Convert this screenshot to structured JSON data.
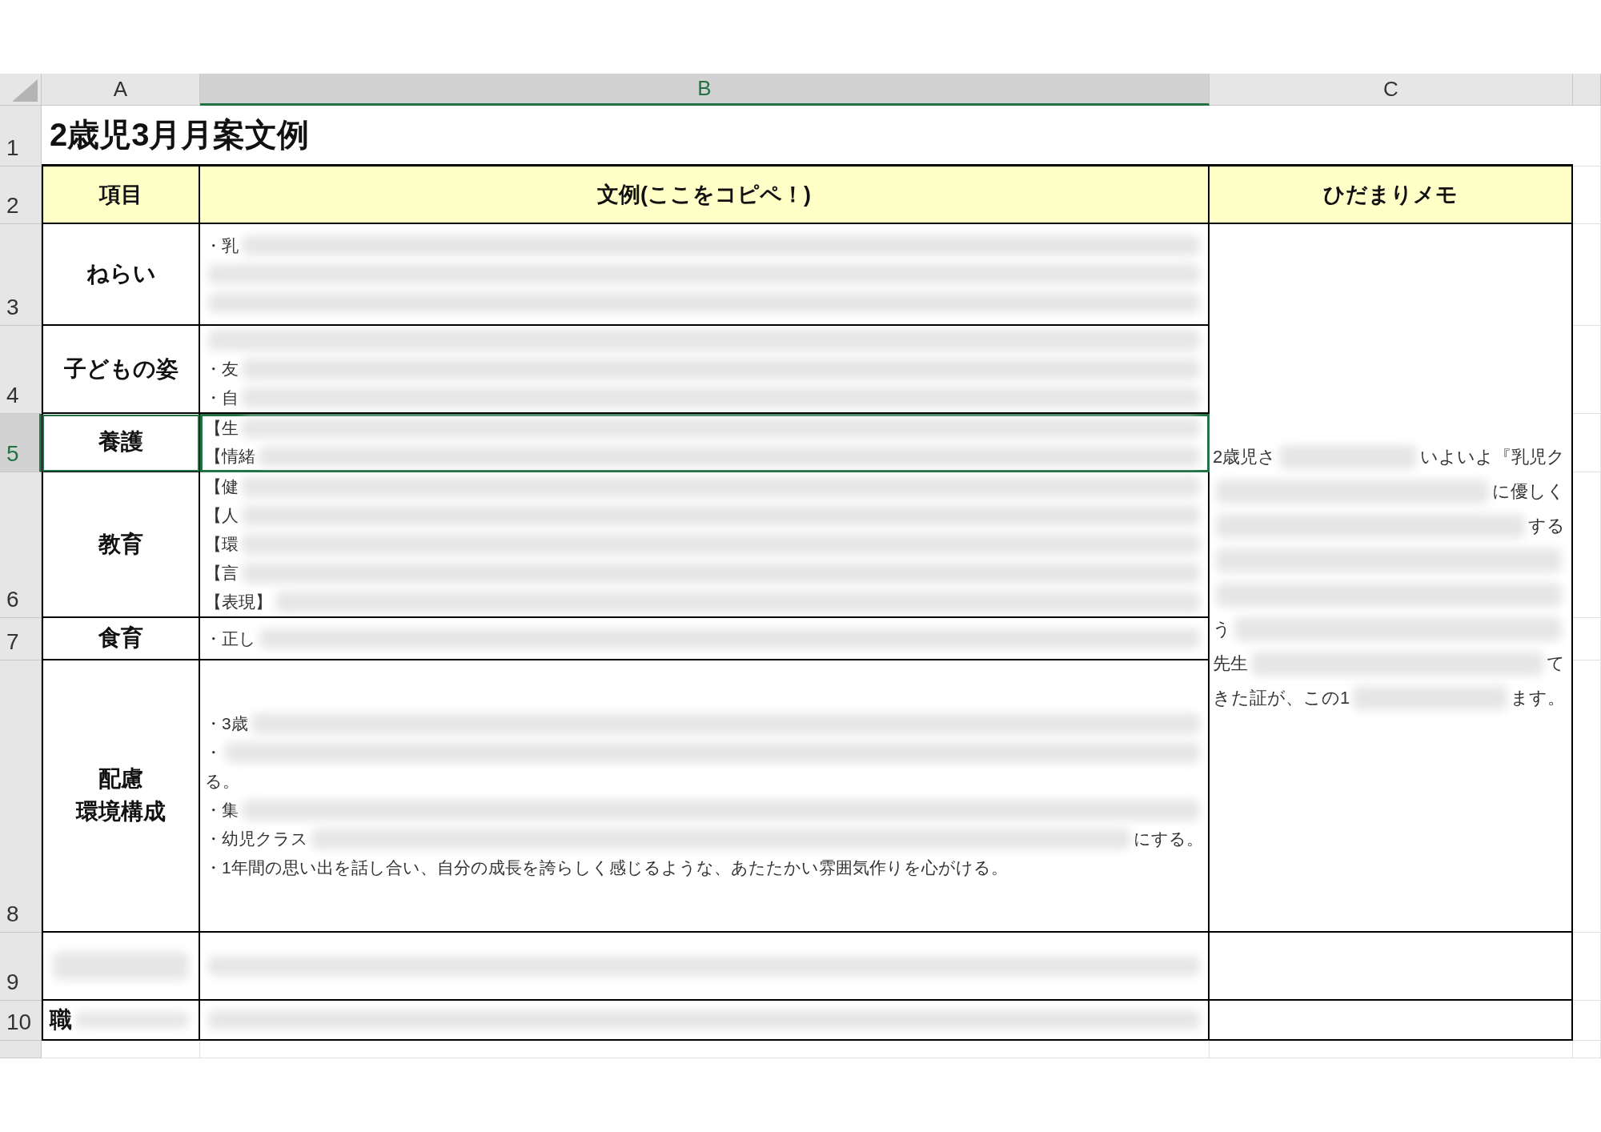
{
  "sheet": {
    "columns": [
      {
        "label": "A",
        "selected": false
      },
      {
        "label": "B",
        "selected": true
      },
      {
        "label": "C",
        "selected": false
      }
    ],
    "rows": [
      {
        "label": "1",
        "selected": false
      },
      {
        "label": "2",
        "selected": false
      },
      {
        "label": "3",
        "selected": false
      },
      {
        "label": "4",
        "selected": false
      },
      {
        "label": "5",
        "selected": true
      },
      {
        "label": "6",
        "selected": false
      },
      {
        "label": "7",
        "selected": false
      },
      {
        "label": "8",
        "selected": false
      },
      {
        "label": "9",
        "selected": false
      },
      {
        "label": "10",
        "selected": false
      }
    ],
    "title": "2歳児3月月案文例",
    "headers": [
      "項目",
      "文例(ここをコピペ！)",
      "ひだまりメモ"
    ],
    "items": [
      {
        "label": "ねらい",
        "selected": false,
        "lines": [
          {
            "text": "・乳",
            "redacted": true
          },
          {
            "redacted": true
          },
          {
            "redacted": true
          }
        ]
      },
      {
        "label": "子どもの姿",
        "selected": false,
        "lines": [
          {
            "redacted": true
          },
          {
            "text": "・友",
            "redacted": true
          },
          {
            "text": "・自",
            "redacted": true
          }
        ]
      },
      {
        "label": "養護",
        "selected": true,
        "lines": [
          {
            "text": "【生",
            "redacted": true
          },
          {
            "text": "【情緒",
            "redacted": true
          }
        ]
      },
      {
        "label": "教育",
        "selected": false,
        "lines": [
          {
            "text": "【健",
            "redacted": true
          },
          {
            "text": "【人",
            "redacted": true
          },
          {
            "text": "【環",
            "redacted": true
          },
          {
            "text": "【言",
            "redacted": true
          },
          {
            "text": "【表現】",
            "redacted": true
          }
        ]
      },
      {
        "label": "食育",
        "selected": false,
        "lines": [
          {
            "text": "・正し",
            "redacted": true
          }
        ]
      },
      {
        "label": [
          "配慮",
          "環境構成"
        ],
        "selected": false,
        "lines": [
          {
            "text": "・3歳",
            "redacted": true
          },
          {
            "text": "・",
            "redacted": true
          },
          {
            "text": "る。"
          },
          {
            "text": "・集",
            "redacted": true
          },
          {
            "text": "・幼児クラス",
            "redacted": true,
            "tail": "にする。"
          },
          {
            "text": "・1年間の思い出を話し合い、自分の成長を誇らしく感じるような、あたたかい雰囲気作りを心がける。"
          }
        ]
      },
      {
        "label_redacted": true,
        "selected": false,
        "lines": [
          {
            "redacted": true
          }
        ]
      },
      {
        "label": "職",
        "label_redacted": true,
        "selected": false,
        "lines": [
          {
            "redacted": true
          }
        ]
      }
    ],
    "memo": [
      {
        "text": "2歳児さ",
        "redacted": true,
        "tail": "いよいよ『乳児ク"
      },
      {
        "redacted": true,
        "tail": "に優しく"
      },
      {
        "redacted": true,
        "tail": "する"
      },
      {
        "redacted": true
      },
      {
        "redacted": true
      },
      {
        "text": "う",
        "redacted": true
      },
      {
        "text": "先生",
        "redacted": true,
        "tail": "て"
      },
      {
        "text": "きた証が、この1",
        "redacted": true,
        "tail": "ます。"
      }
    ]
  }
}
